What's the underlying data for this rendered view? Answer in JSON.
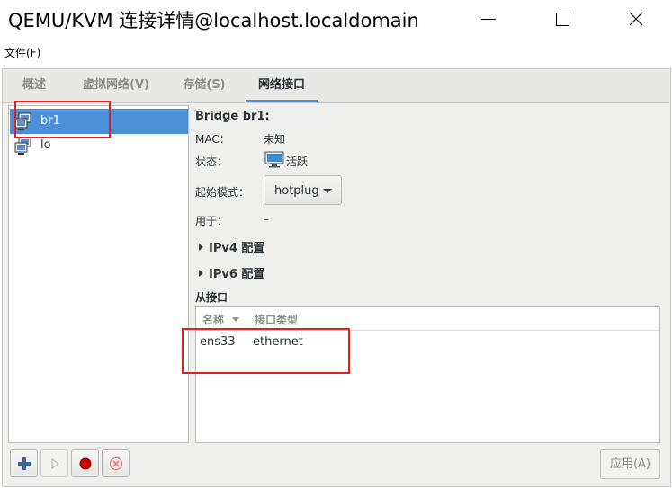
{
  "window": {
    "title": "QEMU/KVM 连接详情@localhost.localdomain",
    "minimize_icon": "minimize-icon",
    "maximize_icon": "maximize-icon",
    "close_icon": "close-icon"
  },
  "menubar": {
    "file": "文件(F)"
  },
  "tabs": [
    {
      "label": "概述"
    },
    {
      "label": "虚拟网络(V)"
    },
    {
      "label": "存储(S)"
    },
    {
      "label": "网络接口"
    }
  ],
  "interfaces": [
    {
      "name": "br1",
      "icon": "network-interface-icon"
    },
    {
      "name": "lo",
      "icon": "network-interface-icon"
    }
  ],
  "details": {
    "header": "Bridge br1:",
    "mac_label": "MAC：",
    "mac_value": "未知",
    "state_label": "状态：",
    "state_value": "活跃",
    "start_mode_label": "起始模式：",
    "start_mode_value": "hotplug",
    "in_use_label": "用于：",
    "in_use_value": "–",
    "ipv4": "IPv4 配置",
    "ipv6": "IPv6 配置",
    "slave_header": "从接口"
  },
  "slave_table": {
    "columns": [
      "名称",
      "接口类型"
    ],
    "rows": [
      {
        "name": "ens33",
        "type": "ethernet"
      }
    ]
  },
  "buttons": {
    "add": "add-icon",
    "start": "play-icon",
    "stop": "stop-icon",
    "delete": "delete-icon",
    "apply": "应用(A)"
  },
  "colors": {
    "accent": "#4a90d9",
    "highlight": "#e02020",
    "stop": "#cc0000"
  }
}
